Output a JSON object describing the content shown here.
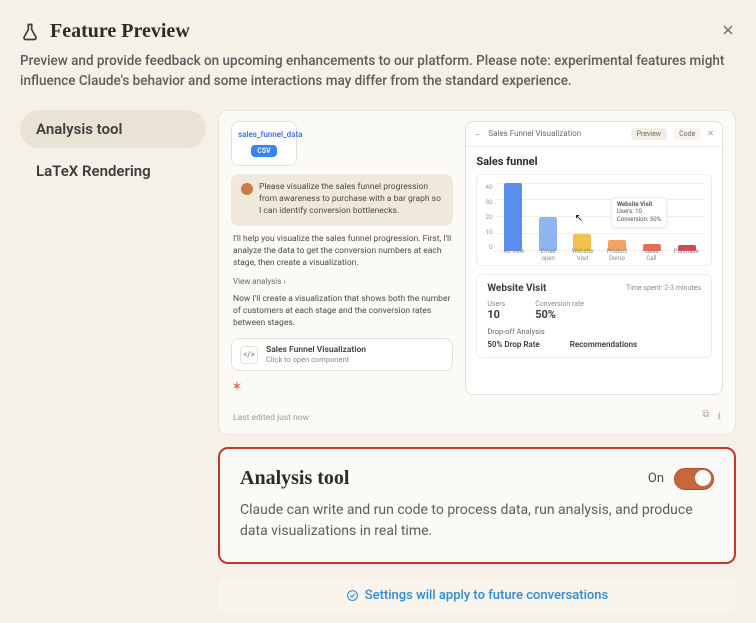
{
  "header": {
    "title": "Feature Preview",
    "subtitle": "Preview and provide feedback on upcoming enhancements to our platform. Please note: experimental features might influence Claude's behavior and some interactions may differ from the standard experience."
  },
  "sidebar": {
    "items": [
      {
        "label": "Analysis tool",
        "active": true
      },
      {
        "label": "LaTeX Rendering",
        "active": false
      }
    ]
  },
  "preview": {
    "file": {
      "name": "sales_funnel_data",
      "badge": "CSV"
    },
    "user_message": "Please visualize the sales funnel progression from awareness to purchase with a bar graph so I can identify conversion bottlenecks.",
    "assistant_1": "I'll help you visualize the sales funnel progression. First, I'll analyze the data to get the conversion numbers at each stage, then create a visualization.",
    "view_analysis": "View analysis  ›",
    "assistant_2": "Now I'll create a visualization that shows both the number of customers at each stage and the conversion rates between stages.",
    "component": {
      "title": "Sales Funnel Visualization",
      "sub": "Click to open component"
    },
    "vis": {
      "header_title": "Sales Funnel Visualization",
      "pill_preview": "Preview",
      "pill_code": "Code",
      "chart_title": "Sales funnel",
      "tooltip": {
        "title": "Website Visit",
        "l1": "Users: 10",
        "l2": "Conversion: 50%"
      },
      "stats": {
        "title": "Website Visit",
        "time": "Time spent: 2-3 minutes",
        "users_label": "Users",
        "users_val": "10",
        "conv_label": "Conversion rate",
        "conv_val": "50%",
        "drop_label": "Drop-off Analysis",
        "drop_a": "50% Drop Rate",
        "drop_b": "Recommendations"
      }
    },
    "footer": "Last edited just now"
  },
  "chart_data": {
    "type": "bar",
    "title": "Sales funnel",
    "ylim": [
      0,
      40
    ],
    "yticks": [
      40,
      30,
      20,
      10,
      0
    ],
    "categories": [
      "Ad view",
      "Email open",
      "Website Visit",
      "Product Demo",
      "Sales Call",
      "Purchase"
    ],
    "values": [
      40,
      20,
      10,
      6,
      4,
      3
    ],
    "colors": [
      "#5b8def",
      "#8fb5f0",
      "#f2c14e",
      "#f4a261",
      "#e76f51",
      "#d64550"
    ]
  },
  "detail": {
    "title": "Analysis tool",
    "state": "On",
    "description": "Claude can write and run code to process data, run analysis, and produce data visualizations in real time."
  },
  "banner": "Settings will apply to future conversations"
}
